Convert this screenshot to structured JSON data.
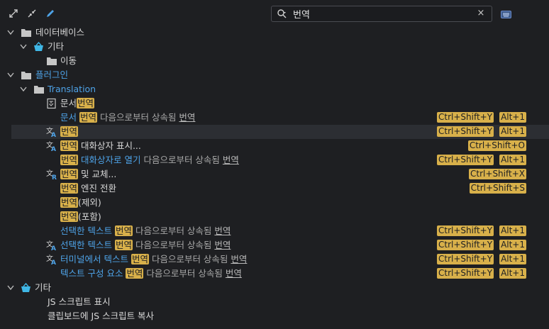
{
  "search": {
    "value": "번역",
    "clear_label": "×"
  },
  "highlight_color": "#d8b04a",
  "accent_blue": "#4ea3e8",
  "tree": {
    "database": {
      "label": "데이터베이스",
      "other": {
        "label": "기타",
        "move": {
          "label": "이동"
        }
      }
    },
    "plugins": {
      "label": "플러그인",
      "translation": {
        "label": "Translation",
        "rows": [
          {
            "parts": [
              [
                "문서",
                ""
              ],
              [
                "번역",
                "hl"
              ]
            ]
          },
          {
            "parts": [
              [
                "문서 ",
                "blue"
              ],
              [
                "번역",
                "hl"
              ],
              [
                " 다음으로부터 상속됨 ",
                "dim"
              ],
              [
                "번역",
                "u"
              ]
            ],
            "keys": [
              "Ctrl+Shift+Y",
              "Alt+1"
            ]
          },
          {
            "parts": [
              [
                "번역",
                "hl"
              ]
            ],
            "keys": [
              "Ctrl+Shift+Y",
              "Alt+1"
            ]
          },
          {
            "parts": [
              [
                "번역",
                "hl"
              ],
              [
                " 대화상자 표시...",
                ""
              ]
            ],
            "keys": [
              "Ctrl+Shift+O"
            ]
          },
          {
            "parts": [
              [
                "번역",
                "hl"
              ],
              [
                " 대화상자로 열기",
                "blue"
              ],
              [
                " 다음으로부터 상속됨 ",
                "dim"
              ],
              [
                "번역",
                "u"
              ]
            ],
            "keys": [
              "Ctrl+Shift+Y",
              "Alt+1"
            ]
          },
          {
            "parts": [
              [
                "번역",
                "hl"
              ],
              [
                " 및 교체...",
                ""
              ]
            ],
            "keys": [
              "Ctrl+Shift+X"
            ]
          },
          {
            "parts": [
              [
                "번역",
                "hl"
              ],
              [
                " 엔진 전환",
                ""
              ]
            ],
            "keys": [
              "Ctrl+Shift+S"
            ]
          },
          {
            "parts": [
              [
                "번역",
                "hl"
              ],
              [
                "(제외)",
                ""
              ]
            ]
          },
          {
            "parts": [
              [
                "번역",
                "hl"
              ],
              [
                "(포함)",
                ""
              ]
            ]
          },
          {
            "parts": [
              [
                "선택한 텍스트 ",
                "blue"
              ],
              [
                "번역",
                "hl"
              ],
              [
                " 다음으로부터 상속됨 ",
                "dim"
              ],
              [
                "번역",
                "u"
              ]
            ],
            "keys": [
              "Ctrl+Shift+Y",
              "Alt+1"
            ]
          },
          {
            "parts": [
              [
                "선택한 텍스트 ",
                "blue"
              ],
              [
                "번역",
                "hl"
              ],
              [
                " 다음으로부터 상속됨 ",
                "dim"
              ],
              [
                "번역",
                "u"
              ]
            ],
            "keys": [
              "Ctrl+Shift+Y",
              "Alt+1"
            ]
          },
          {
            "parts": [
              [
                "터미널에서 텍스트 ",
                "blue"
              ],
              [
                "번역",
                "hl"
              ],
              [
                " 다음으로부터 상속됨 ",
                "dim"
              ],
              [
                "번역",
                "u"
              ]
            ],
            "keys": [
              "Ctrl+Shift+Y",
              "Alt+1"
            ]
          },
          {
            "parts": [
              [
                "텍스트 구성 요소 ",
                "blue"
              ],
              [
                "번역",
                "hl"
              ],
              [
                " 다음으로부터 상속됨 ",
                "dim"
              ],
              [
                "번역",
                "u"
              ]
            ],
            "keys": [
              "Ctrl+Shift+Y",
              "Alt+1"
            ]
          }
        ]
      }
    },
    "other": {
      "label": "기타",
      "items": [
        "JS 스크립트 표시",
        "클립보드에 JS 스크립트 복사"
      ]
    }
  }
}
